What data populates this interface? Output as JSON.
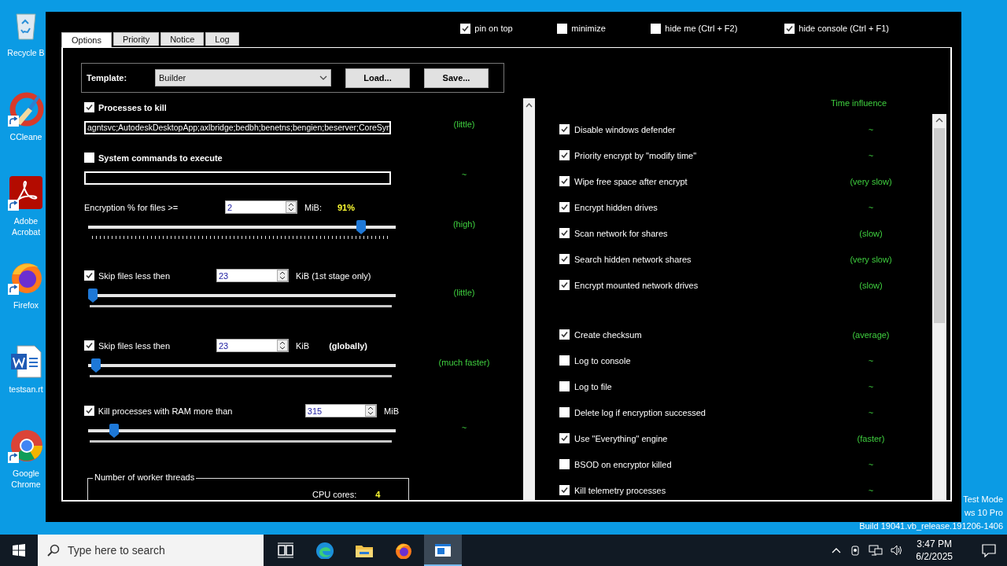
{
  "desktop": {
    "icons": [
      {
        "kind": "recycle-bin",
        "label": "Recycle B",
        "shortcut": false
      },
      {
        "kind": "ccleaner",
        "label": "CCleane",
        "shortcut": true
      },
      {
        "kind": "acrobat",
        "label": "Adobe Acrobat",
        "shortcut": true
      },
      {
        "kind": "firefox",
        "label": "Firefox",
        "shortcut": true
      },
      {
        "kind": "word-doc",
        "label": "testsan.rt",
        "shortcut": false
      },
      {
        "kind": "chrome",
        "label": "Google Chrome",
        "shortcut": true
      }
    ]
  },
  "window": {
    "top_options": [
      {
        "label": "pin on top",
        "checked": true
      },
      {
        "label": "minimize",
        "checked": false
      },
      {
        "label": "hide me (Ctrl + F2)",
        "checked": false
      },
      {
        "label": "hide console (Ctrl + F1)",
        "checked": true
      }
    ],
    "tabs": [
      {
        "label": "Options",
        "selected": true
      },
      {
        "label": "Priority",
        "selected": false
      },
      {
        "label": "Notice",
        "selected": false
      },
      {
        "label": "Log",
        "selected": false
      }
    ],
    "template": {
      "label": "Template:",
      "value": "Builder",
      "buttons": [
        "Load...",
        "Save..."
      ]
    },
    "options": [
      {
        "kind": "text-list",
        "label": "Processes to kill",
        "checked": true,
        "value": "agntsvc;AutodeskDesktopApp;axlbridge;bedbh;benetns;bengien;beserver;CoreSyn",
        "influence": "(little)"
      },
      {
        "kind": "text-list",
        "label": "System commands to execute",
        "checked": false,
        "influence": "~"
      },
      {
        "kind": "percent-slider",
        "label": "Encryption % for files >=",
        "number": "2",
        "unit": "MiB:",
        "reading": "91%",
        "level": 0.9,
        "influence": "(high)"
      },
      {
        "kind": "skip-slider",
        "label": "Skip files less then",
        "checked": true,
        "number": "23",
        "unit": "KiB (1st stage only)",
        "level": 0,
        "influence": "(little)"
      },
      {
        "kind": "skip-slider",
        "label": "Skip files less then",
        "checked": true,
        "number": "23",
        "unit": "KiB",
        "note": "(globally)",
        "level": 0.01,
        "influence": "(much faster)"
      },
      {
        "kind": "ram-slider",
        "label": "Kill processes with RAM more than",
        "checked": true,
        "number": "315",
        "unit": "MiB",
        "level": 0.07,
        "influence": "~"
      }
    ],
    "worker_threads": {
      "title": "Number of worker threads",
      "cpu_label": "CPU cores:",
      "cpu_value": "4"
    },
    "time_influence": {
      "title": "Time influence",
      "groups": [
        [
          {
            "label": "Disable windows defender",
            "checked": true,
            "influence": "~"
          },
          {
            "label": "Priority encrypt by \"modify time\"",
            "checked": true,
            "influence": "~"
          },
          {
            "label": "Wipe free space after encrypt",
            "checked": true,
            "influence": "(very slow)"
          },
          {
            "label": "Encrypt hidden drives",
            "checked": true,
            "influence": "~"
          },
          {
            "label": "Scan network for shares",
            "checked": true,
            "influence": "(slow)"
          },
          {
            "label": "Search hidden network shares",
            "checked": true,
            "influence": "(very slow)"
          },
          {
            "label": "Encrypt mounted network drives",
            "checked": true,
            "influence": "(slow)"
          }
        ],
        [
          {
            "label": "Create checksum",
            "checked": true,
            "influence": "(average)"
          },
          {
            "label": "Log to console",
            "checked": false,
            "influence": "~"
          },
          {
            "label": "Log to file",
            "checked": false,
            "influence": "~"
          },
          {
            "label": "Delete log if encryption successed",
            "checked": false,
            "influence": "~"
          },
          {
            "label": "Use \"Everything\" engine",
            "checked": true,
            "influence": "(faster)"
          },
          {
            "label": "BSOD on encryptor killed",
            "checked": false,
            "influence": "~"
          },
          {
            "label": "Kill telemetry processes",
            "checked": true,
            "influence": "~"
          }
        ]
      ]
    }
  },
  "system_text": [
    "Test Mode",
    "ws 10 Pro",
    "Build 19041.vb_release.191206-1406"
  ],
  "taskbar": {
    "search_placeholder": "Type here to search",
    "apps": [
      {
        "kind": "task-view",
        "selected": false
      },
      {
        "kind": "edge",
        "selected": false
      },
      {
        "kind": "explorer",
        "selected": false
      },
      {
        "kind": "firefox",
        "selected": false
      },
      {
        "kind": "window-app",
        "selected": true
      }
    ],
    "time": "3:47 PM",
    "date": "6/2/2025"
  }
}
